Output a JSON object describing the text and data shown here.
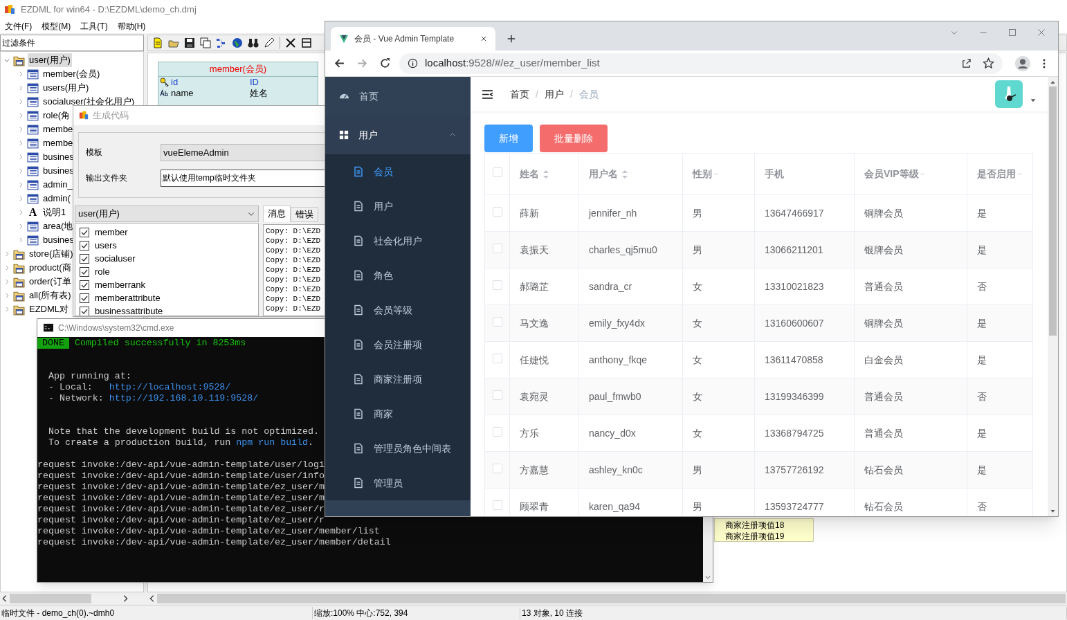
{
  "app_window": {
    "title": "EZDML for win64 - D:\\EZDML\\demo_ch.dmj",
    "menu": [
      "文件(F)",
      "模型(M)",
      "工具(T)",
      "帮助(H)"
    ],
    "filter_label": "过滤条件",
    "tree": [
      {
        "label": "user(用户)",
        "kind": "folder",
        "expanded": true,
        "selected": true,
        "children": [
          {
            "label": "member(会员)",
            "kind": "table",
            "selected": false
          },
          {
            "label": "users(用户)",
            "kind": "table",
            "selected": false
          },
          {
            "label": "socialuser(社会化用户)",
            "kind": "table",
            "selected": false
          },
          {
            "label": "role(角",
            "kind": "table",
            "selected": false
          },
          {
            "label": "membe",
            "kind": "table",
            "selected": false
          },
          {
            "label": "membe",
            "kind": "table",
            "selected": false
          },
          {
            "label": "busines",
            "kind": "table",
            "selected": false
          },
          {
            "label": "busines",
            "kind": "table",
            "selected": false
          },
          {
            "label": "admin_",
            "kind": "table",
            "selected": false
          },
          {
            "label": "admin(",
            "kind": "table",
            "selected": false
          },
          {
            "label": "说明1",
            "kind": "note",
            "glyph": "A",
            "selected": false
          },
          {
            "label": "area(地",
            "kind": "table",
            "selected": false
          },
          {
            "label": "busines",
            "kind": "table",
            "selected": false
          }
        ]
      },
      {
        "label": "store(店铺)",
        "kind": "folder",
        "expanded": false,
        "selected": false
      },
      {
        "label": "product(商",
        "kind": "folder",
        "expanded": false,
        "selected": false
      },
      {
        "label": "order(订单",
        "kind": "folder",
        "expanded": false,
        "selected": false
      },
      {
        "label": "all(所有表)",
        "kind": "folder",
        "expanded": false,
        "selected": false
      },
      {
        "label": "EZDML对",
        "kind": "folder",
        "expanded": false,
        "selected": false
      }
    ],
    "entity": {
      "title": "member(会员)",
      "fields": [
        {
          "name": "id",
          "caption": "ID",
          "kind": "key"
        },
        {
          "name": "name",
          "caption": "姓名",
          "kind": "text"
        }
      ]
    },
    "note": [
      "商家注册项值18",
      "商家注册项值19"
    ],
    "status_bar": [
      "临时文件 - demo_ch(0).~dmh0",
      "缩放:100% 中心:752, 394",
      "13 对象, 10 连接"
    ]
  },
  "code_dialog": {
    "title": "生成代码",
    "template_label": "模板",
    "template_value": "vueElemeAdmin",
    "output_label": "输出文件夹",
    "output_value": "默认使用temp临时文件夹",
    "model_select": "user(用户)",
    "tables": [
      {
        "label": "member",
        "checked": true
      },
      {
        "label": "users",
        "checked": true
      },
      {
        "label": "socialuser",
        "checked": true
      },
      {
        "label": "role",
        "checked": true
      },
      {
        "label": "memberrank",
        "checked": true
      },
      {
        "label": "memberattribute",
        "checked": true
      },
      {
        "label": "businessattribute",
        "checked": true
      }
    ],
    "tabs": [
      {
        "label": "消息",
        "selected": true
      },
      {
        "label": "错误",
        "selected": false
      }
    ],
    "log": [
      "Copy: D:\\EZD",
      "Copy: D:\\EZD",
      "Copy: D:\\EZD",
      "Copy: D:\\EZD",
      "Copy: D:\\EZD",
      "Copy: D:\\EZD",
      "Copy: D:\\EZD",
      "Copy: D:\\EZD",
      "Copy: D:\\EZD"
    ]
  },
  "console": {
    "title": "C:\\Windows\\system32\\cmd.exe",
    "badge": "DONE",
    "message": "Compiled successfully in 8253ms",
    "blocks": [
      [
        [
          {
            "text": "App running at:",
            "kind": "plain"
          }
        ],
        [
          {
            "text": "- Local:   ",
            "kind": "plain"
          },
          {
            "text": "http://localhost:9528/",
            "kind": "link"
          }
        ],
        [
          {
            "text": "- Network: ",
            "kind": "plain"
          },
          {
            "text": "http://192.168.10.119:9528/",
            "kind": "link"
          }
        ]
      ],
      [
        [
          {
            "text": "Note that the development build is not optimized.",
            "kind": "plain"
          }
        ],
        [
          {
            "text": "To create a production build, run ",
            "kind": "plain"
          },
          {
            "text": "npm run build",
            "kind": "link"
          },
          {
            "text": ".",
            "kind": "plain"
          }
        ]
      ]
    ],
    "requests": [
      "request invoke:/dev-api/vue-admin-template/user/logi",
      "request invoke:/dev-api/vue-admin-template/user/info",
      "request invoke:/dev-api/vue-admin-template/ez_user/m",
      "request invoke:/dev-api/vue-admin-template/ez_user/m",
      "request invoke:/dev-api/vue-admin-template/ez_user/r",
      "request invoke:/dev-api/vue-admin-template/ez_user/r",
      "request invoke:/dev-api/vue-admin-template/ez_user/member/list",
      "request invoke:/dev-api/vue-admin-template/ez_user/member/detail"
    ]
  },
  "browser": {
    "tab_title": "会员 - Vue Admin Template",
    "url_host": "localhost",
    "url_rest": ":9528/#/ez_user/member_list",
    "sidebar": [
      {
        "label": "首页",
        "kind": "link"
      },
      {
        "label": "用户",
        "kind": "group",
        "expanded": true,
        "children": [
          {
            "label": "会员",
            "selected": true
          },
          {
            "label": "用户",
            "selected": false
          },
          {
            "label": "社会化用户",
            "selected": false
          },
          {
            "label": "角色",
            "selected": false
          },
          {
            "label": "会员等级",
            "selected": false
          },
          {
            "label": "会员注册项",
            "selected": false
          },
          {
            "label": "商家注册项",
            "selected": false
          },
          {
            "label": "商家",
            "selected": false
          },
          {
            "label": "管理员角色中间表",
            "selected": false
          },
          {
            "label": "管理员",
            "selected": false
          }
        ]
      }
    ],
    "breadcrumb": [
      "首页",
      "用户",
      "会员"
    ],
    "breadcrumb_separator": "/",
    "buttons": [
      {
        "label": "新增",
        "kind": "primary"
      },
      {
        "label": "批量删除",
        "kind": "danger"
      }
    ],
    "table": {
      "all_checked": false,
      "columns": [
        {
          "label": "姓名",
          "sortable": true,
          "filterable": false
        },
        {
          "label": "用户名",
          "sortable": true,
          "filterable": false
        },
        {
          "label": "性别",
          "sortable": false,
          "filterable": true
        },
        {
          "label": "手机",
          "sortable": false,
          "filterable": false
        },
        {
          "label": "会员VIP等级",
          "sortable": false,
          "filterable": true
        },
        {
          "label": "是否启用",
          "sortable": false,
          "filterable": true
        }
      ],
      "rows": [
        {
          "checked": false,
          "cells": [
            "薛新",
            "jennifer_nh",
            "男",
            "13647466917",
            "铜牌会员",
            "是"
          ]
        },
        {
          "checked": false,
          "cells": [
            "袁振天",
            "charles_qj5mu0",
            "男",
            "13066211201",
            "银牌会员",
            "是"
          ]
        },
        {
          "checked": false,
          "cells": [
            "郝璐芷",
            "sandra_cr",
            "女",
            "13310021823",
            "普通会员",
            "否"
          ]
        },
        {
          "checked": false,
          "cells": [
            "马文逸",
            "emily_fxy4dx",
            "女",
            "13160600607",
            "铜牌会员",
            "是"
          ]
        },
        {
          "checked": false,
          "cells": [
            "任婕悦",
            "anthony_fkqe",
            "女",
            "13611470858",
            "白金会员",
            "是"
          ]
        },
        {
          "checked": false,
          "cells": [
            "袁宛灵",
            "paul_fmwb0",
            "女",
            "13199346399",
            "普通会员",
            "否"
          ]
        },
        {
          "checked": false,
          "cells": [
            "方乐",
            "nancy_d0x",
            "女",
            "13368794725",
            "普通会员",
            "是"
          ]
        },
        {
          "checked": false,
          "cells": [
            "方嘉慧",
            "ashley_kn0c",
            "男",
            "13757726192",
            "钻石会员",
            "是"
          ]
        },
        {
          "checked": false,
          "cells": [
            "顾翠青",
            "karen_qa94",
            "男",
            "13593724777",
            "钻石会员",
            "否"
          ]
        }
      ]
    }
  }
}
